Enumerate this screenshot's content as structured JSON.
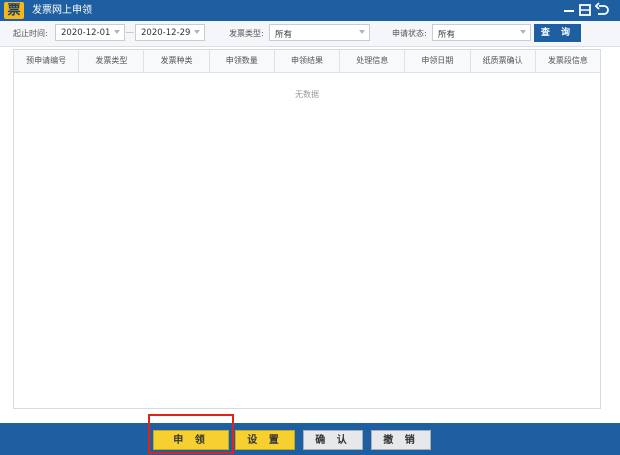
{
  "window": {
    "logo_char": "票",
    "title": "发票网上申领",
    "controls": {
      "minimize": "–",
      "maximize": "□",
      "back": "↺"
    }
  },
  "filters": {
    "date_label": "起止时间:",
    "start_date": "2020-12-01",
    "end_date": "2020-12-29",
    "type_label": "发票类型:",
    "type_value": "所有",
    "status_label": "申请状态:",
    "status_value": "所有",
    "query_label": "查 询"
  },
  "table": {
    "columns": [
      "预申请编号",
      "发票类型",
      "发票种类",
      "申领数量",
      "申领结果",
      "处理信息",
      "申领日期",
      "纸质票确认",
      "发票段信息"
    ],
    "empty_text": "无数据"
  },
  "actions": {
    "apply": "申 领",
    "settings": "设 置",
    "confirm": "确 认",
    "revoke": "撤 销"
  },
  "colors": {
    "primary": "#1e5fa2",
    "yellow_button": "#f5d030",
    "highlight_border": "#e0221b",
    "logo": "#f3b81b"
  }
}
